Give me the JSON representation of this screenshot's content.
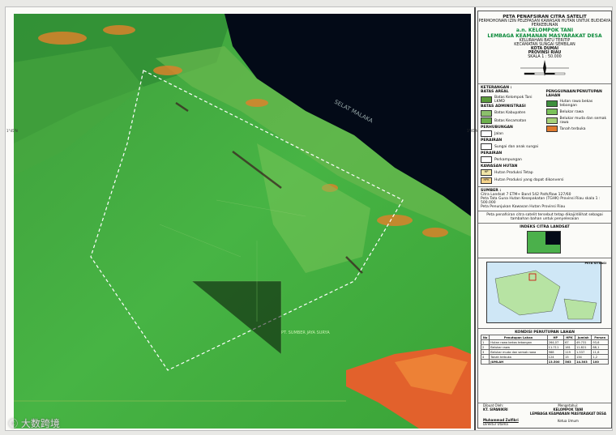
{
  "map": {
    "sea_label": "SELAT MALAKA",
    "area_label": "PT. SUMBER JAYA SURYA",
    "side_labels": [
      "1°45'N",
      "1°45'N"
    ],
    "colors": {
      "vegetation": "#3aa83a",
      "sea": "#000814",
      "clearing": "#d9822b",
      "boundary": "#ffffff"
    }
  },
  "panel": {
    "title": "PETA PENAFSIRAN CITRA SATELIT",
    "subtitle": "PERMOHONAN IZIN PELEPASAN KAWASAN HUTAN UNTUK BUDIDAYA PERKEBUNAN",
    "an": "a.n. KELOMPOK TANI",
    "org": "LEMBAGA KEAMANAN MASYARAKAT DESA",
    "location": [
      "KELURAHAN BATU TERITIP",
      "KECAMATAN SUNGAI SEMBILAN",
      "KOTA DUMAI",
      "PROVINSI RIAU"
    ],
    "scale": "SKALA 1 : 50.000",
    "legend_title": "KETERANGAN :",
    "legend_left": [
      {
        "group": "BATAS AREAL",
        "items": [
          {
            "label": "Batas Kelompok Tani LKMD",
            "color": "#5c9c3c"
          }
        ]
      },
      {
        "group": "BATAS ADMINISTRASI",
        "items": [
          {
            "label": "Batas Kabupaten",
            "color": "#8cc06c"
          },
          {
            "label": "Batas Kecamatan",
            "color": "#6cb04c"
          }
        ]
      },
      {
        "group": "PERHUBUNGAN",
        "items": [
          {
            "label": "Jalan",
            "color": "#ffffff"
          }
        ]
      },
      {
        "group": "PERAIRAN",
        "items": [
          {
            "label": "Sungai dan anak sungai",
            "color": "#ffffff"
          }
        ]
      },
      {
        "group": "PERAIRAN",
        "items": [
          {
            "label": "Perkampungan",
            "color": "#ffffff"
          }
        ]
      }
    ],
    "legend_right_title": "PENGGUNAAN/PENUTUPAN LAHAN",
    "legend_right": [
      {
        "label": "Hutan rawa bekas tebangan",
        "color": "#3e8f3e"
      },
      {
        "label": "Belukar rawa",
        "color": "#7bc25a"
      },
      {
        "label": "Belukar muda dan semak rawa",
        "color": "#a7d27a"
      },
      {
        "label": "Tanah terbuka",
        "color": "#e07a2e"
      }
    ],
    "kawasan_title": "KAWASAN HUTAN",
    "kawasan": [
      {
        "code": "HP",
        "label": "Hutan Produksi Tetap",
        "color": "#f2e6a8"
      },
      {
        "code": "HPK",
        "label": "Hutan Produksi yang dapat dikonversi",
        "color": "#f6d38a"
      }
    ],
    "sumber_title": "SUMBER :",
    "sumber": [
      "Citra Landsat 7 ETM+ Band 542 Path/Row 127/60",
      "Peta Tata Guna Hutan Kesepakatan (TGHK) Provinsi Riau skala 1 : 500.000",
      "Peta Penunjukan Kawasan Hutan Provinsi Riau"
    ],
    "note": "Peta penafsiran citra satelit tersebut tetap dikaji/dilihat sebagai tambahan bahan untuk penyelesaian",
    "inset_title": "INDEKS CITRA LANDSAT",
    "inset2_title": "PETA SITUASI",
    "table_title": "KONDISI PENUTUPAN LAHAN",
    "table_headers": [
      "No",
      "Penutupan Lahan",
      "HP",
      "HPK",
      "Jumlah",
      "Persen"
    ],
    "table_rows": [
      [
        "1",
        "Hutan rawa bekas tebangan",
        "264,07",
        "67",
        "49.731",
        "93,6"
      ],
      [
        "2",
        "Belukar rawa",
        "11.711",
        "161",
        "11.821",
        "88,1"
      ],
      [
        "3",
        "Belukar muda dan semak rawa",
        "988",
        "119",
        "1.537",
        "11,6"
      ],
      [
        "4",
        "Tanah terbuka",
        "124",
        "15",
        "134",
        "1,2"
      ],
      [
        "",
        "JUMLAH",
        "13.500",
        "563",
        "14.303",
        "100"
      ]
    ],
    "sig_left": [
      "Dibuat Oleh:",
      "KT. SIPANIKRI",
      "Muhammad Zulfikri",
      "Direktur Utama"
    ],
    "sig_right": [
      "Mengetahui:",
      "KELOMPOK TANI",
      "LEMBAGA KEAMANAN MASYARAKAT DESA",
      "Ketua Umum"
    ]
  },
  "watermark": "ⓒ 大数跨境"
}
